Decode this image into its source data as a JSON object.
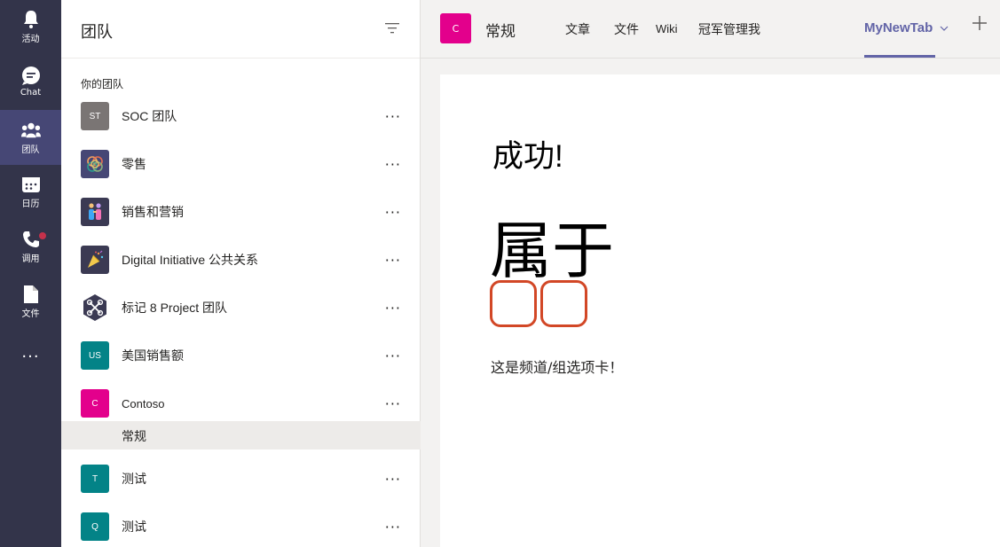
{
  "rail": {
    "items": [
      {
        "label": "活动",
        "icon": "bell-icon"
      },
      {
        "label": "Chat",
        "icon": "chat-icon"
      },
      {
        "label": "团队",
        "icon": "teams-icon"
      },
      {
        "label": "日历",
        "icon": "calendar-icon"
      },
      {
        "label": "调用",
        "icon": "phone-icon"
      },
      {
        "label": "文件",
        "icon": "file-icon"
      }
    ],
    "more": "···"
  },
  "panel": {
    "title": "团队",
    "section_label": "你的团队",
    "teams": [
      {
        "name": "SOC 团队",
        "avatar_text": "ST",
        "avatar_color": "#7a7574"
      },
      {
        "name": "零售",
        "avatar_text": "",
        "avatar_color": "#464775"
      },
      {
        "name": "销售和营销",
        "avatar_text": "",
        "avatar_color": "#3b3a53"
      },
      {
        "name": "Digital Initiative 公共关系",
        "avatar_text": "",
        "avatar_color": "#3b3a53"
      },
      {
        "name": "标记 8 Project 团队",
        "avatar_text": "",
        "avatar_color": "#3b3a53"
      },
      {
        "name": "美国销售额",
        "avatar_text": "US",
        "avatar_color": "#038387"
      },
      {
        "name": "Contoso",
        "avatar_text": "C",
        "avatar_color": "#e3008c"
      },
      {
        "name": "测试",
        "avatar_text": "T",
        "avatar_color": "#038387"
      },
      {
        "name": "测试",
        "avatar_text": "Q",
        "avatar_color": "#038387"
      }
    ],
    "selected_channel": "常规",
    "more_label": "···"
  },
  "topbar": {
    "channel_avatar": "C",
    "channel_name": "常规",
    "tabs": [
      "文章",
      "文件",
      "Wiki",
      "冠军管理我"
    ],
    "active_tab": "MyNewTab",
    "accent": "#6264a7"
  },
  "content": {
    "heading": "成功!",
    "big_text": "属于",
    "note": "这是频道/组选项卡！"
  }
}
